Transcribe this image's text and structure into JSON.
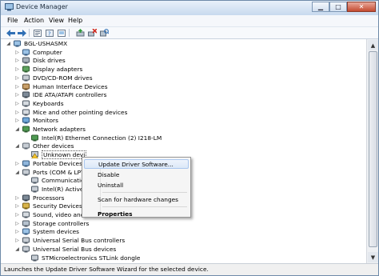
{
  "window": {
    "title": "Device Manager"
  },
  "menu": [
    "File",
    "Action",
    "View",
    "Help"
  ],
  "toolbar": [
    "back-icon",
    "forward-icon",
    "properties-icon",
    "help-icon",
    "show-hidden-icon",
    "update-driver-icon",
    "uninstall-icon",
    "scan-hardware-icon"
  ],
  "tree": [
    {
      "label": "BGL-USHASMX",
      "level": 0,
      "expander": "open",
      "icon": "computer-root-icon"
    },
    {
      "label": "Computer",
      "level": 1,
      "expander": "closed",
      "icon": "computer-icon"
    },
    {
      "label": "Disk drives",
      "level": 1,
      "expander": "closed",
      "icon": "disk-drive-icon"
    },
    {
      "label": "Display adapters",
      "level": 1,
      "expander": "closed",
      "icon": "display-adapter-icon"
    },
    {
      "label": "DVD/CD-ROM drives",
      "level": 1,
      "expander": "closed",
      "icon": "dvd-drive-icon"
    },
    {
      "label": "Human Interface Devices",
      "level": 1,
      "expander": "closed",
      "icon": "hid-icon"
    },
    {
      "label": "IDE ATA/ATAPI controllers",
      "level": 1,
      "expander": "closed",
      "icon": "ide-controller-icon"
    },
    {
      "label": "Keyboards",
      "level": 1,
      "expander": "closed",
      "icon": "keyboard-icon"
    },
    {
      "label": "Mice and other pointing devices",
      "level": 1,
      "expander": "closed",
      "icon": "mouse-icon"
    },
    {
      "label": "Monitors",
      "level": 1,
      "expander": "closed",
      "icon": "monitor-icon"
    },
    {
      "label": "Network adapters",
      "level": 1,
      "expander": "open",
      "icon": "network-adapter-icon"
    },
    {
      "label": "Intel(R) Ethernet Connection (2) I218-LM",
      "level": 2,
      "expander": "none",
      "icon": "network-card-icon"
    },
    {
      "label": "Other devices",
      "level": 1,
      "expander": "open",
      "icon": "other-devices-icon"
    },
    {
      "label": "Unknown devi",
      "level": 2,
      "expander": "none",
      "icon": "warning-device-icon",
      "selected": true
    },
    {
      "label": "Portable Devices",
      "level": 1,
      "expander": "closed",
      "icon": "portable-device-icon"
    },
    {
      "label": "Ports (COM & LPT",
      "level": 1,
      "expander": "open",
      "icon": "port-icon"
    },
    {
      "label": "Communicatio",
      "level": 2,
      "expander": "none",
      "icon": "com-port-icon"
    },
    {
      "label": "Intel(R) Active",
      "level": 2,
      "expander": "none",
      "icon": "com-port-icon"
    },
    {
      "label": "Processors",
      "level": 1,
      "expander": "closed",
      "icon": "processor-icon"
    },
    {
      "label": "Security Devices",
      "level": 1,
      "expander": "closed",
      "icon": "security-device-icon"
    },
    {
      "label": "Sound, video and",
      "level": 1,
      "expander": "closed",
      "icon": "sound-icon"
    },
    {
      "label": "Storage controllers",
      "level": 1,
      "expander": "closed",
      "icon": "storage-controller-icon"
    },
    {
      "label": "System devices",
      "level": 1,
      "expander": "closed",
      "icon": "system-device-icon"
    },
    {
      "label": "Universal Serial Bus controllers",
      "level": 1,
      "expander": "closed",
      "icon": "usb-icon"
    },
    {
      "label": "Universal Serial Bus devices",
      "level": 1,
      "expander": "open",
      "icon": "usb-icon"
    },
    {
      "label": "STMicroelectronics STLink dongle",
      "level": 2,
      "expander": "none",
      "icon": "usb-device-icon"
    }
  ],
  "context_menu": [
    {
      "label": "Update Driver Software...",
      "highlighted": true
    },
    {
      "label": "Disable"
    },
    {
      "label": "Uninstall"
    },
    {
      "separator": true
    },
    {
      "label": "Scan for hardware changes"
    },
    {
      "separator": true
    },
    {
      "label": "Properties",
      "bold": true
    }
  ],
  "status": {
    "text": "Launches the Update Driver Software Wizard for the selected device."
  },
  "colors": {
    "accent": "#3b6ea5",
    "selection_border": "#555555",
    "menu_highlight": "#dbe8f8"
  }
}
